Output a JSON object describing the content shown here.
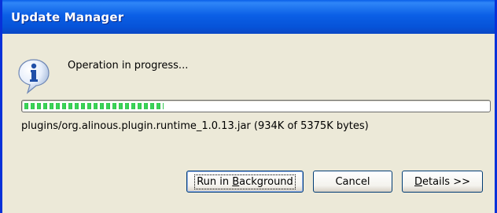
{
  "window": {
    "title": "Update Manager"
  },
  "icon": {
    "name": "information-icon",
    "glyph": "i"
  },
  "message": "Operation in progress...",
  "progress": {
    "fraction": 0.3
  },
  "status_text": "plugins/org.alinous.plugin.runtime_1.0.13.jar (934K of 5375K bytes)",
  "buttons": {
    "run_in_background": {
      "before": "Run in ",
      "mnemonic": "B",
      "after": "ackground"
    },
    "cancel": {
      "label": "Cancel"
    },
    "details": {
      "mnemonic": "D",
      "after": "etails >>"
    }
  },
  "colors": {
    "titlebar": "#0a5fe8",
    "progress_fill": "#2fc34a",
    "dialog_background": "#ece9d8"
  }
}
